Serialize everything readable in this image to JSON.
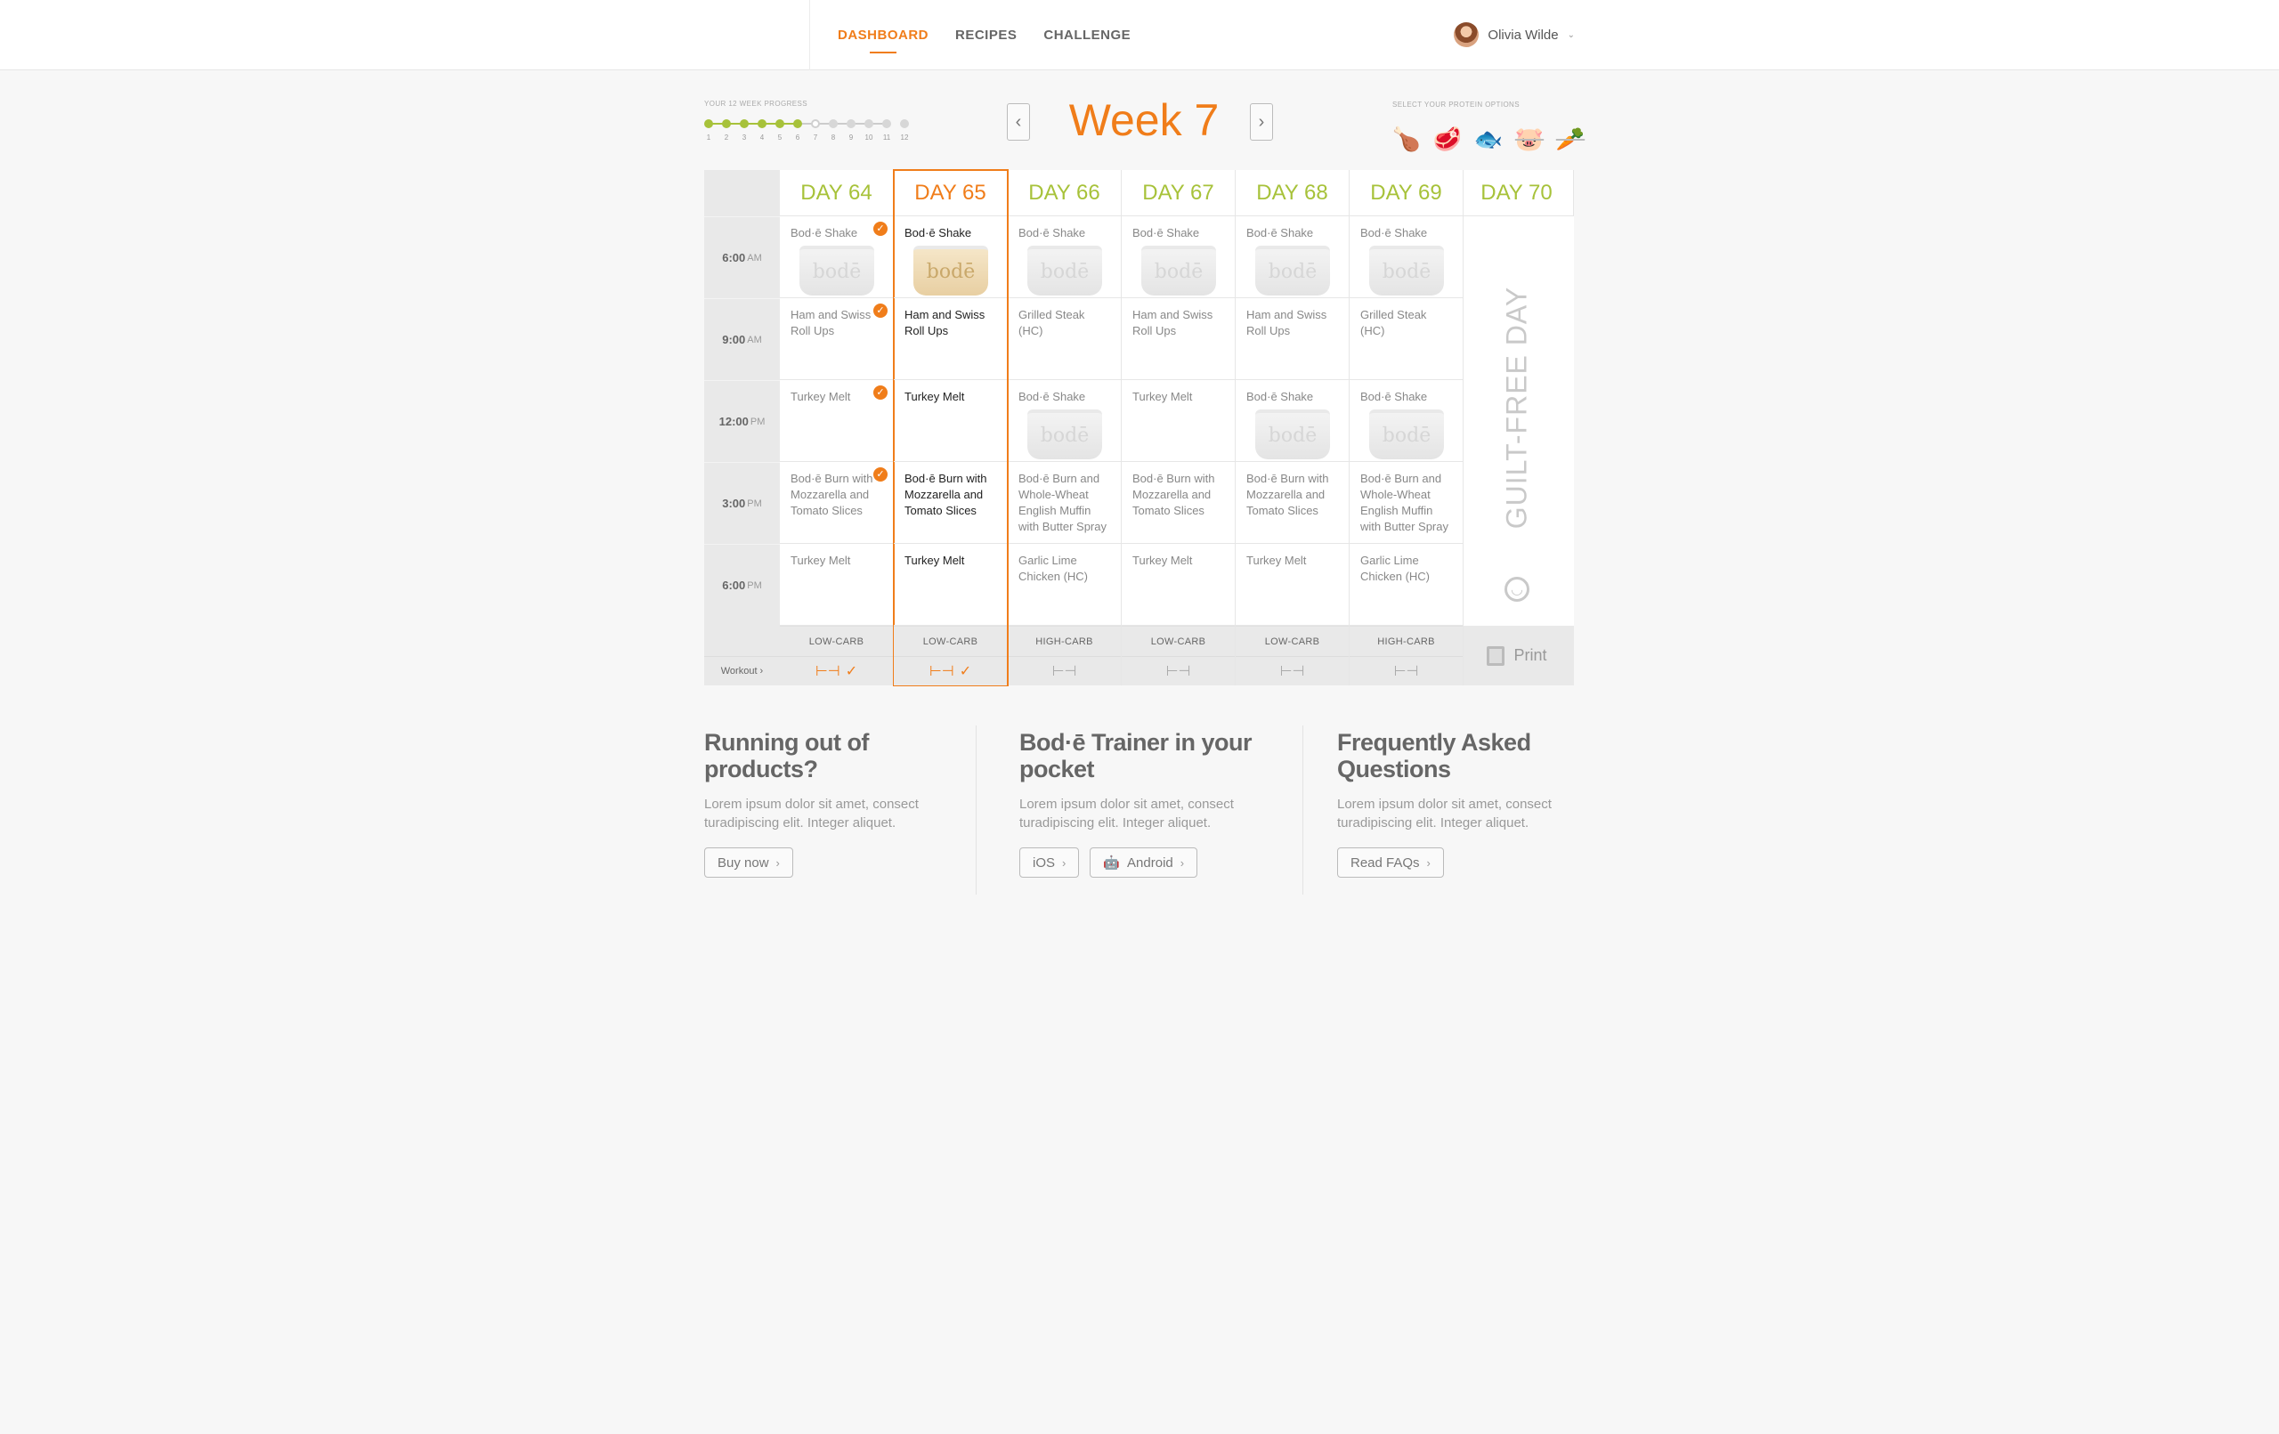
{
  "nav": {
    "items": [
      {
        "label": "DASHBOARD",
        "active": true
      },
      {
        "label": "RECIPES",
        "active": false
      },
      {
        "label": "CHALLENGE",
        "active": false
      }
    ],
    "user_name": "Olivia Wilde",
    "caret": "⌄"
  },
  "progress": {
    "label": "YOUR 12 WEEK PROGRESS",
    "weeks": [
      "1",
      "2",
      "3",
      "4",
      "5",
      "6",
      "7",
      "8",
      "9",
      "10",
      "11",
      "12"
    ],
    "completed_weeks": 6,
    "current_week": 7
  },
  "week": {
    "title": "Week 7",
    "prev": "‹",
    "next": "›"
  },
  "protein": {
    "label": "SELECT YOUR PROTEIN OPTIONS",
    "icons": [
      {
        "name": "chicken-leg-icon",
        "glyph": "🍗",
        "enabled": true
      },
      {
        "name": "beef-icon",
        "glyph": "🥩",
        "enabled": true
      },
      {
        "name": "fish-icon",
        "glyph": "🐟",
        "enabled": true
      },
      {
        "name": "pork-icon",
        "glyph": "🐷",
        "enabled": false
      },
      {
        "name": "vegetarian-icon",
        "glyph": "🥕",
        "enabled": false
      }
    ]
  },
  "times": [
    {
      "time": "6:00",
      "ampm": "AM"
    },
    {
      "time": "9:00",
      "ampm": "AM"
    },
    {
      "time": "12:00",
      "ampm": "PM"
    },
    {
      "time": "3:00",
      "ampm": "PM"
    },
    {
      "time": "6:00",
      "ampm": "PM"
    }
  ],
  "workout_label": "Workout ›",
  "cup_brand": "bodē",
  "check": "✓",
  "days": [
    {
      "label": "DAY 64",
      "selected": false,
      "carb": "LOW-CARB",
      "workout_done": true,
      "meals": [
        {
          "text": "Bod·ē Shake",
          "shake": true,
          "checked": true
        },
        {
          "text": "Ham and Swiss Roll Ups",
          "shake": false,
          "checked": true
        },
        {
          "text": "Turkey Melt",
          "shake": false,
          "checked": true
        },
        {
          "text": "Bod·ē Burn with Mozzarella and Tomato Slices",
          "shake": false,
          "checked": true
        },
        {
          "text": "Turkey Melt",
          "shake": false,
          "checked": false
        }
      ]
    },
    {
      "label": "DAY 65",
      "selected": true,
      "carb": "LOW-CARB",
      "workout_done": true,
      "meals": [
        {
          "text": "Bod·ē Shake",
          "shake": true,
          "checked": false
        },
        {
          "text": "Ham and Swiss Roll Ups",
          "shake": false,
          "checked": false
        },
        {
          "text": "Turkey Melt",
          "shake": false,
          "checked": false
        },
        {
          "text": "Bod·ē Burn with Mozzarella and Tomato Slices",
          "shake": false,
          "checked": false
        },
        {
          "text": "Turkey Melt",
          "shake": false,
          "checked": false
        }
      ]
    },
    {
      "label": "DAY 66",
      "selected": false,
      "carb": "HIGH-CARB",
      "workout_done": false,
      "meals": [
        {
          "text": "Bod·ē Shake",
          "shake": true,
          "checked": false
        },
        {
          "text": "Grilled Steak (HC)",
          "shake": false,
          "checked": false
        },
        {
          "text": "Bod·ē Shake",
          "shake": true,
          "checked": false
        },
        {
          "text": "Bod·ē Burn and Whole-Wheat English Muffin with Butter Spray",
          "shake": false,
          "checked": false
        },
        {
          "text": "Garlic Lime Chicken (HC)",
          "shake": false,
          "checked": false
        }
      ]
    },
    {
      "label": "DAY 67",
      "selected": false,
      "carb": "LOW-CARB",
      "workout_done": false,
      "meals": [
        {
          "text": "Bod·ē Shake",
          "shake": true,
          "checked": false
        },
        {
          "text": "Ham and Swiss Roll Ups",
          "shake": false,
          "checked": false
        },
        {
          "text": "Turkey Melt",
          "shake": false,
          "checked": false
        },
        {
          "text": "Bod·ē Burn with Mozzarella and Tomato Slices",
          "shake": false,
          "checked": false
        },
        {
          "text": "Turkey Melt",
          "shake": false,
          "checked": false
        }
      ]
    },
    {
      "label": "DAY 68",
      "selected": false,
      "carb": "LOW-CARB",
      "workout_done": false,
      "meals": [
        {
          "text": "Bod·ē Shake",
          "shake": true,
          "checked": false
        },
        {
          "text": "Ham and Swiss Roll Ups",
          "shake": false,
          "checked": false
        },
        {
          "text": "Bod·ē Shake",
          "shake": true,
          "checked": false
        },
        {
          "text": "Bod·ē Burn with Mozzarella and Tomato Slices",
          "shake": false,
          "checked": false
        },
        {
          "text": "Turkey Melt",
          "shake": false,
          "checked": false
        }
      ]
    },
    {
      "label": "DAY 69",
      "selected": false,
      "carb": "HIGH-CARB",
      "workout_done": false,
      "meals": [
        {
          "text": "Bod·ē Shake",
          "shake": true,
          "checked": false
        },
        {
          "text": "Grilled Steak (HC)",
          "shake": false,
          "checked": false
        },
        {
          "text": "Bod·ē Shake",
          "shake": true,
          "checked": false
        },
        {
          "text": "Bod·ē Burn and Whole-Wheat English Muffin with Butter Spray",
          "shake": false,
          "checked": false
        },
        {
          "text": "Garlic Lime Chicken (HC)",
          "shake": false,
          "checked": false
        }
      ]
    }
  ],
  "day70": {
    "label": "DAY 70",
    "guilt_text": "GUILT-FREE DAY",
    "smile": "◡",
    "print_label": "Print"
  },
  "info": [
    {
      "title": "Running out of products?",
      "body": "Lorem ipsum dolor sit amet, consect turadipiscing elit. Integer aliquet.",
      "buttons": [
        {
          "label": "Buy now",
          "icon": ""
        }
      ]
    },
    {
      "title": "Bod·ē Trainer in your pocket",
      "body": "Lorem ipsum dolor sit amet, consect turadipiscing elit. Integer aliquet.",
      "buttons": [
        {
          "label": "iOS",
          "icon": ""
        },
        {
          "label": "Android",
          "icon": "🤖"
        }
      ]
    },
    {
      "title": "Frequently Asked Questions",
      "body": "Lorem ipsum dolor sit amet, consect turadipiscing elit. Integer aliquet.",
      "buttons": [
        {
          "label": "Read FAQs",
          "icon": ""
        }
      ]
    }
  ],
  "colors": {
    "accent": "#f07d1a",
    "green": "#a7c23a"
  }
}
